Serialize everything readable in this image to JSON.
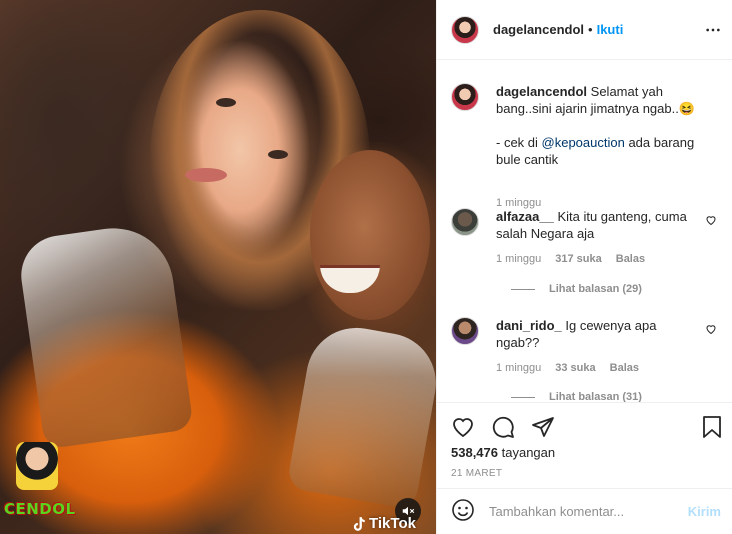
{
  "media": {
    "watermark_text": "CENDOL",
    "tiktok_label": "TikTok",
    "mute_icon": "speaker-muted-icon",
    "brand_color_tiktok": "#ffffff"
  },
  "header": {
    "username": "dagelancendol",
    "separator": "•",
    "follow_label": "Ikuti",
    "more_icon": "more-horizontal-icon"
  },
  "caption": {
    "username": "dagelancendol",
    "text_part1": "Selamat yah bang..sini ajarin jimatnya ngab..",
    "emoji": "😆",
    "text_part2_prefix": "- cek di ",
    "mention": "@kepoauction",
    "text_part2_suffix": " ada barang bule cantik",
    "time": "1 minggu"
  },
  "comments": [
    {
      "username": "alfazaa__",
      "text": "Kita itu ganteng, cuma salah Negara aja",
      "time": "1 minggu",
      "likes": "317 suka",
      "reply_label": "Balas",
      "view_replies": "Lihat balasan (29)"
    },
    {
      "username": "dani_rido_",
      "text": "Ig cewenya apa ngab??",
      "time": "1 minggu",
      "likes": "33 suka",
      "reply_label": "Balas",
      "view_replies": "Lihat balasan (31)"
    }
  ],
  "actions": {
    "views_count": "538,476",
    "views_label": "tayangan",
    "date": "21 MARET"
  },
  "add_comment": {
    "placeholder": "Tambahkan komentar...",
    "post_label": "Kirim"
  },
  "colors": {
    "accent": "#0095f6",
    "post_disabled": "#b2dffc",
    "mention": "#00376b",
    "secondary_text": "#8e8e8e"
  }
}
